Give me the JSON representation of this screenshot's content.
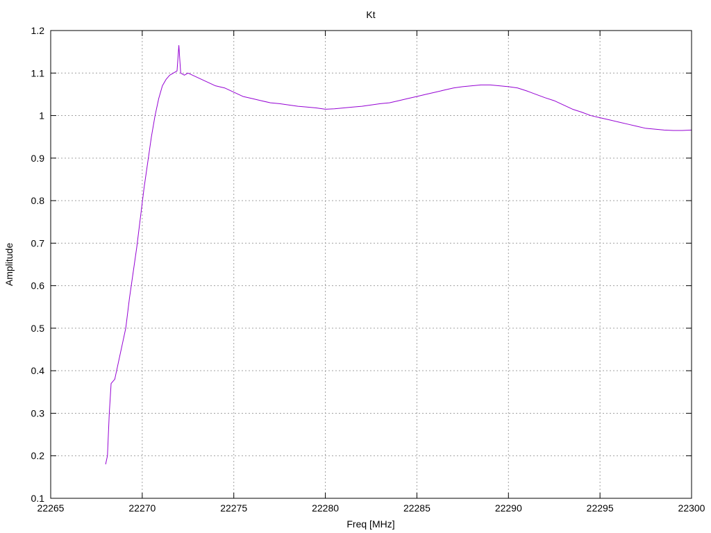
{
  "chart_data": {
    "type": "line",
    "title": "Kt",
    "xlabel": "Freq [MHz]",
    "ylabel": "Amplitude",
    "xlim": [
      22265,
      22300
    ],
    "ylim": [
      0.1,
      1.2
    ],
    "grid": true,
    "legend": "none",
    "colors": {
      "series": "#9400d3",
      "grid": "#a0a0a0",
      "axes": "#000000"
    },
    "x_ticks": [
      "22265",
      "22270",
      "22275",
      "22280",
      "22285",
      "22290",
      "22295",
      "22300"
    ],
    "y_ticks": [
      "0.1",
      "0.2",
      "0.3",
      "0.4",
      "0.5",
      "0.6",
      "0.7",
      "0.8",
      "0.9",
      "1",
      "1.1",
      "1.2"
    ],
    "series": [
      {
        "x": [
          22268.0,
          22268.1,
          22268.2,
          22268.3,
          22268.5,
          22268.7,
          22268.9,
          22269.1,
          22269.3,
          22269.5,
          22269.7,
          22269.9,
          22270.1,
          22270.3,
          22270.5,
          22270.7,
          22270.9,
          22271.1,
          22271.3,
          22271.5,
          22271.7,
          22271.9,
          22272.0,
          22272.1,
          22272.3,
          22272.5,
          22273.0,
          22273.5,
          22274.0,
          22274.5,
          22275.0,
          22275.5,
          22276.0,
          22276.5,
          22277.0,
          22277.5,
          22278.0,
          22278.5,
          22279.0,
          22279.5,
          22280.0,
          22280.5,
          22281.0,
          22281.5,
          22282.0,
          22282.5,
          22283.0,
          22283.5,
          22284.0,
          22284.5,
          22285.0,
          22285.5,
          22286.0,
          22286.5,
          22287.0,
          22287.5,
          22288.0,
          22288.5,
          22289.0,
          22289.5,
          22290.0,
          22290.5,
          22291.0,
          22291.5,
          22292.0,
          22292.5,
          22293.0,
          22293.5,
          22294.0,
          22294.5,
          22295.0,
          22295.5,
          22296.0,
          22296.5,
          22297.0,
          22297.5,
          22298.0,
          22298.5,
          22299.0,
          22299.5,
          22300.0
        ],
        "y": [
          0.18,
          0.2,
          0.3,
          0.37,
          0.38,
          0.42,
          0.46,
          0.5,
          0.57,
          0.63,
          0.69,
          0.76,
          0.83,
          0.89,
          0.95,
          1.0,
          1.04,
          1.07,
          1.085,
          1.095,
          1.1,
          1.105,
          1.165,
          1.1,
          1.095,
          1.1,
          1.09,
          1.08,
          1.07,
          1.065,
          1.055,
          1.045,
          1.04,
          1.035,
          1.03,
          1.028,
          1.025,
          1.022,
          1.02,
          1.018,
          1.015,
          1.016,
          1.018,
          1.02,
          1.022,
          1.025,
          1.028,
          1.03,
          1.035,
          1.04,
          1.045,
          1.05,
          1.055,
          1.06,
          1.065,
          1.068,
          1.07,
          1.072,
          1.072,
          1.07,
          1.068,
          1.065,
          1.058,
          1.05,
          1.042,
          1.035,
          1.025,
          1.015,
          1.008,
          1.0,
          0.995,
          0.99,
          0.985,
          0.98,
          0.975,
          0.97,
          0.968,
          0.966,
          0.965,
          0.965,
          0.966
        ]
      }
    ]
  }
}
